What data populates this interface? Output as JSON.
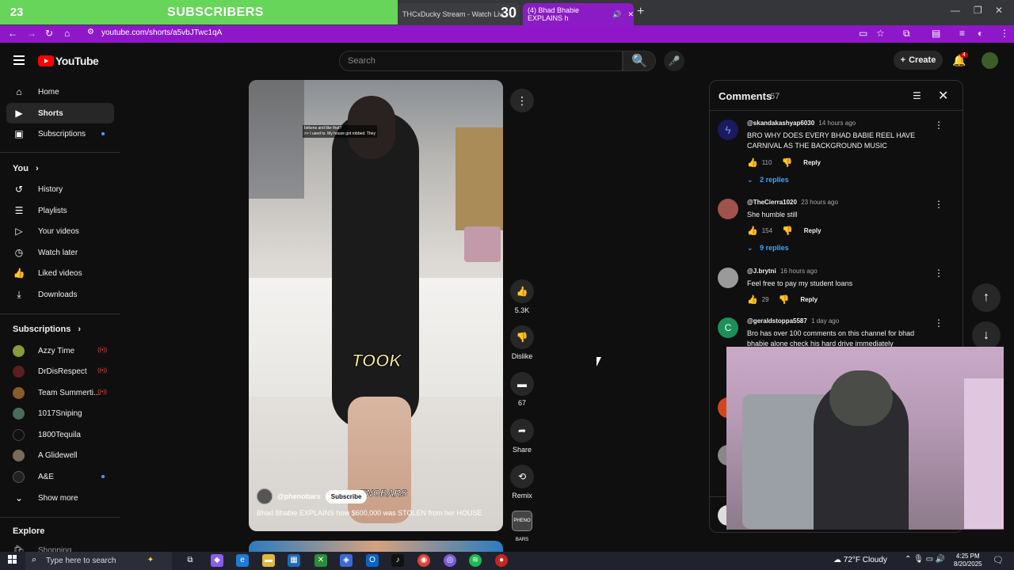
{
  "browser": {
    "overlay": {
      "count": "23",
      "label": "SUBSCRIBERS"
    },
    "tabs": [
      {
        "title": "THCxDucky Stream - Watch Liv",
        "counter": "30"
      },
      {
        "title": "(4) Bhad Bhabie EXPLAINS h"
      }
    ],
    "url": "youtube.com/shorts/a5vbJTwc1qA"
  },
  "header": {
    "logo": "YouTube",
    "search_placeholder": "Search",
    "create_label": "Create",
    "notification_count": "4"
  },
  "sidebar": {
    "main": [
      {
        "label": "Home",
        "icon": "home-icon"
      },
      {
        "label": "Shorts",
        "icon": "shorts-icon"
      },
      {
        "label": "Subscriptions",
        "icon": "subscriptions-icon"
      }
    ],
    "you_heading": "You",
    "you_items": [
      {
        "label": "History",
        "icon": "history-icon"
      },
      {
        "label": "Playlists",
        "icon": "playlists-icon"
      },
      {
        "label": "Your videos",
        "icon": "your-videos-icon"
      },
      {
        "label": "Watch later",
        "icon": "watch-later-icon"
      },
      {
        "label": "Liked videos",
        "icon": "liked-videos-icon"
      },
      {
        "label": "Downloads",
        "icon": "downloads-icon"
      }
    ],
    "subscriptions_heading": "Subscriptions",
    "channels": [
      {
        "name": "Azzy Time",
        "status": "live"
      },
      {
        "name": "DrDisRespect",
        "status": "live"
      },
      {
        "name": "Team Summerti...",
        "status": "live"
      },
      {
        "name": "1017Sniping",
        "status": "none"
      },
      {
        "name": "1800Tequila",
        "status": "none"
      },
      {
        "name": "A Glidewell",
        "status": "none"
      },
      {
        "name": "A&E",
        "status": "new"
      }
    ],
    "show_more": "Show more",
    "explore_heading": "Explore",
    "explore_partial": "Shopping"
  },
  "short": {
    "overlay_caption_line1": "birkens and like that?",
    "overlay_caption_line2": ">> I used to. My house got robbed. They",
    "big_caption": "TOOK",
    "watermark": "ENOBARS",
    "channel": "@phenobars",
    "subscribe_label": "Subscribe",
    "title": "Bhad Bhabie EXPLAINS how $600,000 was STOLEN from her HOUSE",
    "likes": "5.3K",
    "dislike_label": "Dislike",
    "comments_count": "67",
    "share_label": "Share",
    "remix_label": "Remix",
    "sound_label": "PHENO BARS"
  },
  "comments": {
    "title": "Comments",
    "count": "67",
    "items": [
      {
        "handle": "@skandakashyap6030",
        "time": "14 hours ago",
        "text": "BRO WHY DOES EVERY BHAD BABIE REEL HAVE CARNIVAL AS THE BACKGROUND MUSIC",
        "likes": "110",
        "reply": "Reply",
        "replies": "2 replies",
        "avatar_color": "#1a1a5e"
      },
      {
        "handle": "@TheCierra1020",
        "time": "23 hours ago",
        "text": "She humble still",
        "likes": "154",
        "reply": "Reply",
        "replies": "9 replies",
        "avatar_color": "#a0524d"
      },
      {
        "handle": "@J.brytni",
        "time": "16 hours ago",
        "text": "Feel free to pay my student loans",
        "likes": "29",
        "reply": "Reply",
        "avatar_color": "#9a9a9a"
      },
      {
        "handle": "@geraldstoppa5587",
        "time": "1 day ago",
        "text": "Bro has over 100 comments on this channel for bhad bhabie alone check his hard drive immediately",
        "avatar_color": "#1e8e5a",
        "avatar_letter": "C"
      }
    ]
  },
  "taskbar": {
    "search_placeholder": "Type here to search",
    "weather": "72°F  Cloudy",
    "time": "4:25 PM",
    "date": "8/20/2025"
  },
  "colors": {
    "youtube_red": "#ff0000",
    "browser_accent": "#8f17c9",
    "overlay_green": "#67d45a",
    "link_blue": "#3ea6ff"
  }
}
